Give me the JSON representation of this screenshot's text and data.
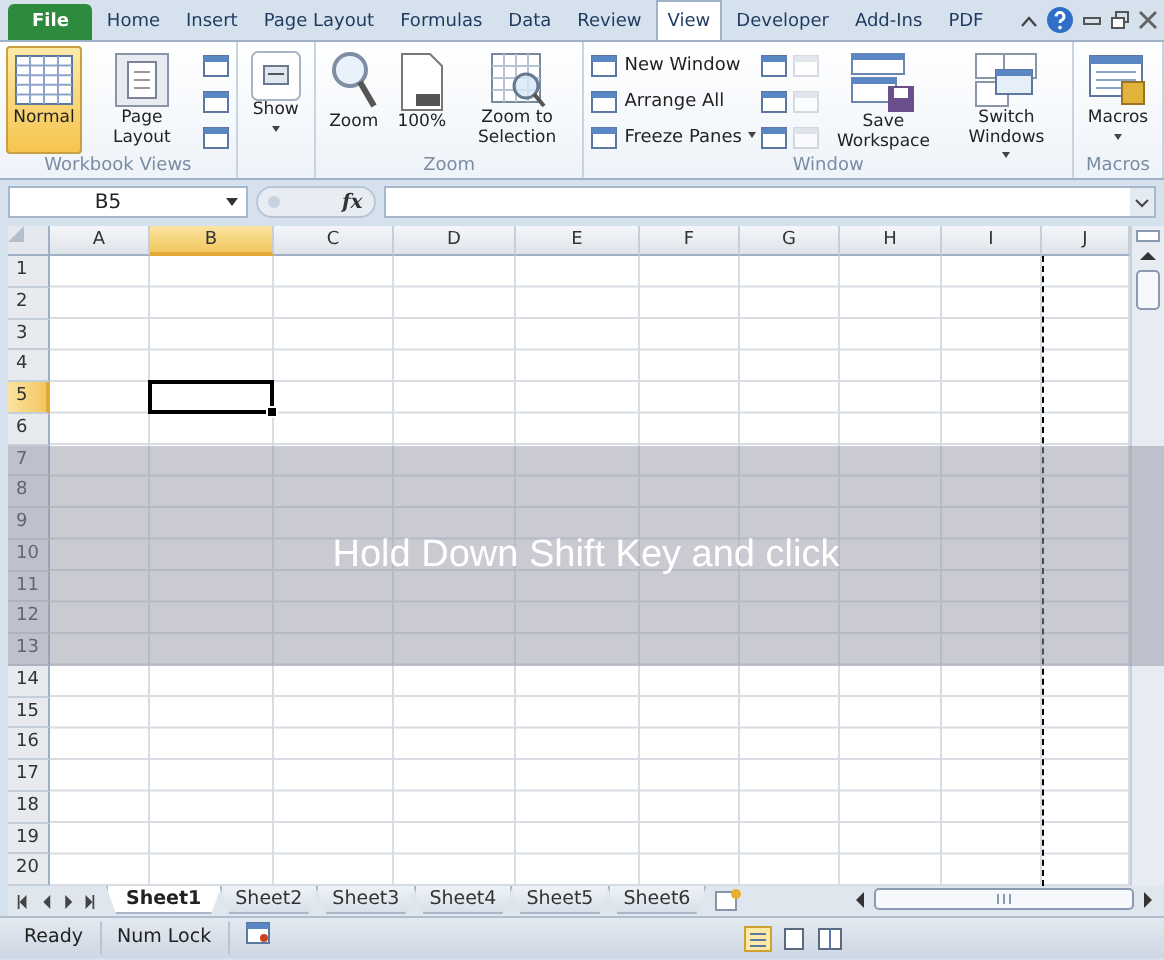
{
  "ribbon_tabs": [
    {
      "label": "File",
      "kind": "file",
      "selected": false
    },
    {
      "label": "Home",
      "kind": "tab",
      "selected": false
    },
    {
      "label": "Insert",
      "kind": "tab",
      "selected": false
    },
    {
      "label": "Page Layout",
      "kind": "tab",
      "selected": false
    },
    {
      "label": "Formulas",
      "kind": "tab",
      "selected": false
    },
    {
      "label": "Data",
      "kind": "tab",
      "selected": false
    },
    {
      "label": "Review",
      "kind": "tab",
      "selected": false
    },
    {
      "label": "View",
      "kind": "tab",
      "selected": true
    },
    {
      "label": "Developer",
      "kind": "tab",
      "selected": false
    },
    {
      "label": "Add-Ins",
      "kind": "tab",
      "selected": false
    },
    {
      "label": "PDF",
      "kind": "tab",
      "selected": false
    }
  ],
  "ribbon_groups": [
    {
      "label": "Workbook Views",
      "controls": [
        {
          "kind": "large",
          "label": "Normal",
          "selected": true
        },
        {
          "kind": "large",
          "label": "Page Layout",
          "selected": false
        },
        {
          "kind": "stack",
          "items": [
            {
              "disabled": false
            },
            {
              "disabled": false
            },
            {
              "disabled": false
            }
          ]
        }
      ]
    },
    {
      "controls": [
        {
          "kind": "large",
          "label": "Show",
          "dropdown": true,
          "selected": false
        }
      ]
    },
    {
      "label": "Zoom",
      "controls": [
        {
          "kind": "large",
          "label": "Zoom",
          "selected": false
        },
        {
          "kind": "large",
          "label": "100%",
          "selected": false
        },
        {
          "kind": "large",
          "label": "Zoom to Selection",
          "selected": false
        }
      ]
    },
    {
      "label": "Window",
      "controls": [
        {
          "kind": "stack",
          "items": [
            {
              "label": "New Window",
              "disabled": false
            },
            {
              "label": "Arrange All",
              "disabled": false
            },
            {
              "label": "Freeze Panes",
              "dropdown": true,
              "disabled": false
            }
          ]
        },
        {
          "kind": "stack",
          "items": [
            {
              "disabled": false
            },
            {
              "disabled": false
            },
            {
              "disabled": false
            }
          ]
        },
        {
          "kind": "stack",
          "items": [
            {
              "disabled": true
            },
            {
              "disabled": true
            },
            {
              "disabled": true
            }
          ]
        },
        {
          "kind": "large",
          "label": "Save Workspace",
          "selected": false
        },
        {
          "kind": "large",
          "label": "Switch Windows",
          "dropdown": true,
          "selected": false
        }
      ]
    },
    {
      "label": "Macros",
      "controls": [
        {
          "kind": "large",
          "label": "Macros",
          "dropdown": true,
          "selected": false
        }
      ]
    }
  ],
  "formula_bar": {
    "name_box": "B5",
    "function_button": "fx"
  },
  "grid": {
    "columns": [
      {
        "label": "A",
        "selected": false
      },
      {
        "label": "B",
        "selected": true
      },
      {
        "label": "C",
        "selected": false
      },
      {
        "label": "D",
        "selected": false
      },
      {
        "label": "E",
        "selected": false
      },
      {
        "label": "F",
        "selected": false
      },
      {
        "label": "G",
        "selected": false
      },
      {
        "label": "H",
        "selected": false
      },
      {
        "label": "I",
        "selected": false
      },
      {
        "label": "J",
        "selected": false
      }
    ],
    "rows": [
      {
        "label": "1",
        "selected": false
      },
      {
        "label": "2",
        "selected": false
      },
      {
        "label": "3",
        "selected": false
      },
      {
        "label": "4",
        "selected": false
      },
      {
        "label": "5",
        "selected": true
      },
      {
        "label": "6",
        "selected": false
      },
      {
        "label": "7",
        "selected": false
      },
      {
        "label": "8",
        "selected": false
      },
      {
        "label": "9",
        "selected": false
      },
      {
        "label": "10",
        "selected": false
      },
      {
        "label": "11",
        "selected": false
      },
      {
        "label": "12",
        "selected": false
      },
      {
        "label": "13",
        "selected": false
      },
      {
        "label": "14",
        "selected": false
      },
      {
        "label": "15",
        "selected": false
      },
      {
        "label": "16",
        "selected": false
      },
      {
        "label": "17",
        "selected": false
      },
      {
        "label": "18",
        "selected": false
      },
      {
        "label": "19",
        "selected": false
      },
      {
        "label": "20",
        "selected": false
      }
    ],
    "overlay": {
      "text": "Hold Down Shift Key and click"
    }
  },
  "sheet_tabs": [
    {
      "label": "Sheet1",
      "selected": true
    },
    {
      "label": "Sheet2",
      "selected": false
    },
    {
      "label": "Sheet3",
      "selected": false
    },
    {
      "label": "Sheet4",
      "selected": false
    },
    {
      "label": "Sheet5",
      "selected": false
    },
    {
      "label": "Sheet6",
      "selected": false
    }
  ],
  "status_bar": {
    "items": [
      "Ready",
      "Num Lock"
    ]
  }
}
